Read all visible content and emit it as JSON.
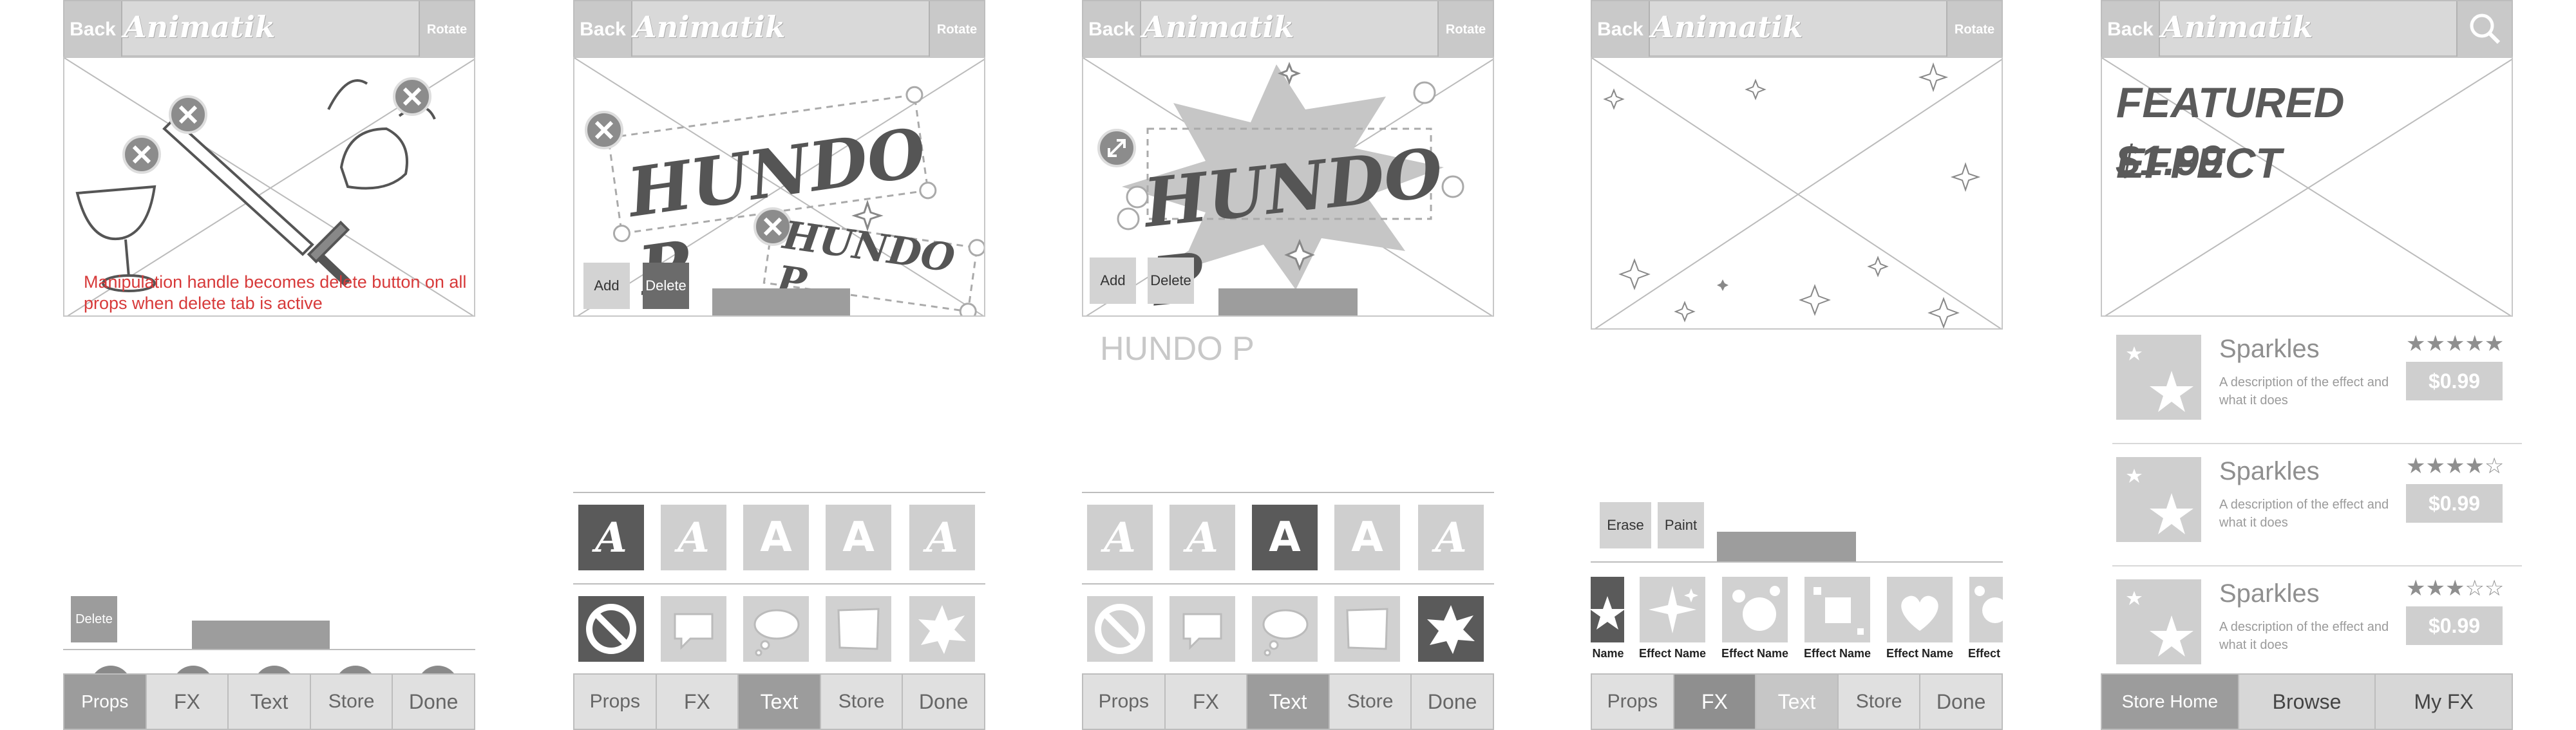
{
  "common": {
    "back_label": "Back",
    "logo_text": "Animatik",
    "rotate_label": "Rotate"
  },
  "screen1": {
    "delete_label": "Delete",
    "annotation": "Manipulation handle becomes delete button on all props when delete tab is active",
    "annotation_color": "#d73a3a",
    "tabs": [
      "Props",
      "FX",
      "Text",
      "Store",
      "Done"
    ],
    "active_tab": "Props"
  },
  "screen2": {
    "headline_large": "HUNDO P",
    "headline_small": "HUNDO P",
    "add_label": "Add",
    "delete_label": "Delete",
    "font_tiles": [
      "A",
      "A",
      "A",
      "A",
      "A"
    ],
    "tabs": [
      "Props",
      "FX",
      "Text",
      "Store",
      "Done"
    ],
    "active_tab": "Text"
  },
  "screen3": {
    "headline": "HUNDO P",
    "caption": "HUNDO P",
    "add_label": "Add",
    "delete_label": "Delete",
    "font_tiles": [
      "A",
      "A",
      "A",
      "A",
      "A"
    ],
    "tabs": [
      "Props",
      "FX",
      "Text",
      "Store",
      "Done"
    ],
    "active_tab": "Text"
  },
  "screen4": {
    "erase_label": "Erase",
    "paint_label": "Paint",
    "effects": [
      "Name",
      "Effect Name",
      "Effect Name",
      "Effect Name",
      "Effect Name",
      "Effect"
    ],
    "effect_icons": [
      "star-icon",
      "sparkle-icon",
      "bubbles-icon",
      "square-icon",
      "heart-icon",
      "circles-icon"
    ],
    "tabs": [
      "Props",
      "FX",
      "Text",
      "Store",
      "Done"
    ],
    "active_tab": "FX"
  },
  "screen5": {
    "featured_title": "FEATURED EFFECT",
    "featured_price": "$1.99",
    "items": [
      {
        "name": "Sparkles",
        "desc": "A description of the effect and what it does",
        "stars": "★★★★★",
        "price": "$0.99",
        "rating": 5
      },
      {
        "name": "Sparkles",
        "desc": "A description of the effect and what it does",
        "stars": "★★★★☆",
        "price": "$0.99",
        "rating": 4
      },
      {
        "name": "Sparkles",
        "desc": "A description of the effect and what it does",
        "stars": "★★★☆☆",
        "price": "$0.99",
        "rating": 3
      }
    ],
    "store_tabs": [
      "Store Home",
      "Browse",
      "My FX"
    ],
    "active_tab": "Store Home"
  }
}
